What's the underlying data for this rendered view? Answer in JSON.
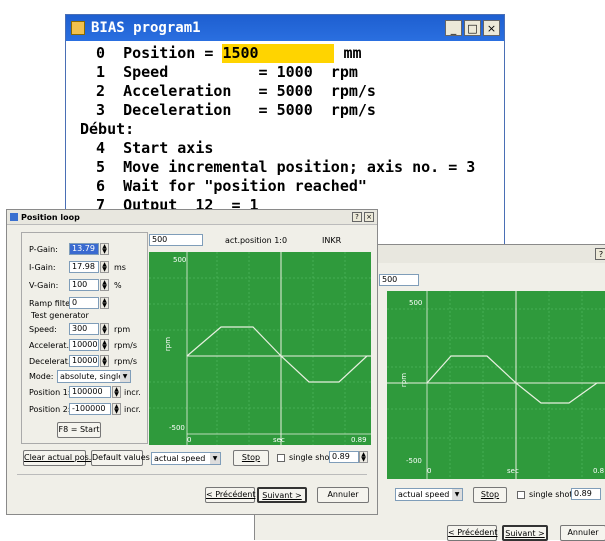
{
  "bias": {
    "title": "BIAS program1",
    "controls": {
      "minimize": "_",
      "maximize": "□",
      "close": "×"
    },
    "lines": [
      {
        "num": "0",
        "text": "Position =",
        "value": "1500",
        "unit": "mm"
      },
      {
        "num": "1",
        "text": "Speed          = 1000  rpm"
      },
      {
        "num": "2",
        "text": "Acceleration   = 5000  rpm/s"
      },
      {
        "num": "3",
        "text": "Deceleration   = 5000  rpm/s"
      },
      {
        "label": "Début:"
      },
      {
        "num": "4",
        "text": "Start axis"
      },
      {
        "num": "5",
        "text": "Move incremental position; axis no. = 3"
      },
      {
        "num": "6",
        "text": "Wait for \"position reached\""
      },
      {
        "num": "7",
        "text": "Output  12  = 1"
      }
    ]
  },
  "dialog_front": {
    "title": "Position loop",
    "controls": {
      "help": "?",
      "close": "×"
    },
    "gains": [
      {
        "label": "P-Gain:",
        "value": "13.79",
        "unit": ""
      },
      {
        "label": "I-Gain:",
        "value": "17.98",
        "unit": "ms"
      },
      {
        "label": "V-Gain:",
        "value": "100",
        "unit": "%"
      },
      {
        "label": "Ramp filter:",
        "value": "0",
        "unit": ""
      }
    ],
    "test_generator_label": "Test generator",
    "test": [
      {
        "label": "Speed:",
        "value": "300",
        "unit": "rpm"
      },
      {
        "label": "Accelerat.:",
        "value": "10000",
        "unit": "rpm/s"
      },
      {
        "label": "Decelerat.:",
        "value": "10000",
        "unit": "rpm/s"
      }
    ],
    "mode_label": "Mode:",
    "mode_value": "absolute, single",
    "positions": [
      {
        "label": "Position 1:",
        "value": "100000",
        "unit": "incr."
      },
      {
        "label": "Position 2:",
        "value": "-100000",
        "unit": "incr."
      }
    ],
    "start_button": "F8 = Start",
    "clear_button": "Clear actual pos.",
    "default_button": "Default values",
    "scale_value": "500",
    "act_position": "act.position 1:0",
    "inkr": "INKR",
    "plot": {
      "ymax": "500",
      "ymin": "-500",
      "ylabel": "rpm",
      "xmin": "0",
      "xlabel": "sec",
      "xmax": "0.89"
    },
    "signal_select": "actual speed",
    "stop_button": "Stop",
    "single_shot": "single shot",
    "time_value": "0.89",
    "nav": {
      "back": "< Précédent",
      "next": "Suivant >",
      "cancel": "Annuler"
    }
  },
  "dialog_back": {
    "help": "?",
    "scale_value": "500",
    "plot": {
      "ymax": "500",
      "ymin": "-500",
      "ylabel": "rpm",
      "xmin": "0",
      "xlabel": "sec",
      "xmax": "0.8"
    },
    "signal_select": "actual speed",
    "stop_button": "Stop",
    "single_shot": "single shot",
    "time_value": "0.89",
    "nav": {
      "back": "< Précédent",
      "next": "Suivant >",
      "cancel": "Annuler"
    }
  },
  "colors": {
    "plot_bg": "#2f9a3c",
    "highlight": "#ffd400",
    "bias_title": "#1e5fd0"
  }
}
